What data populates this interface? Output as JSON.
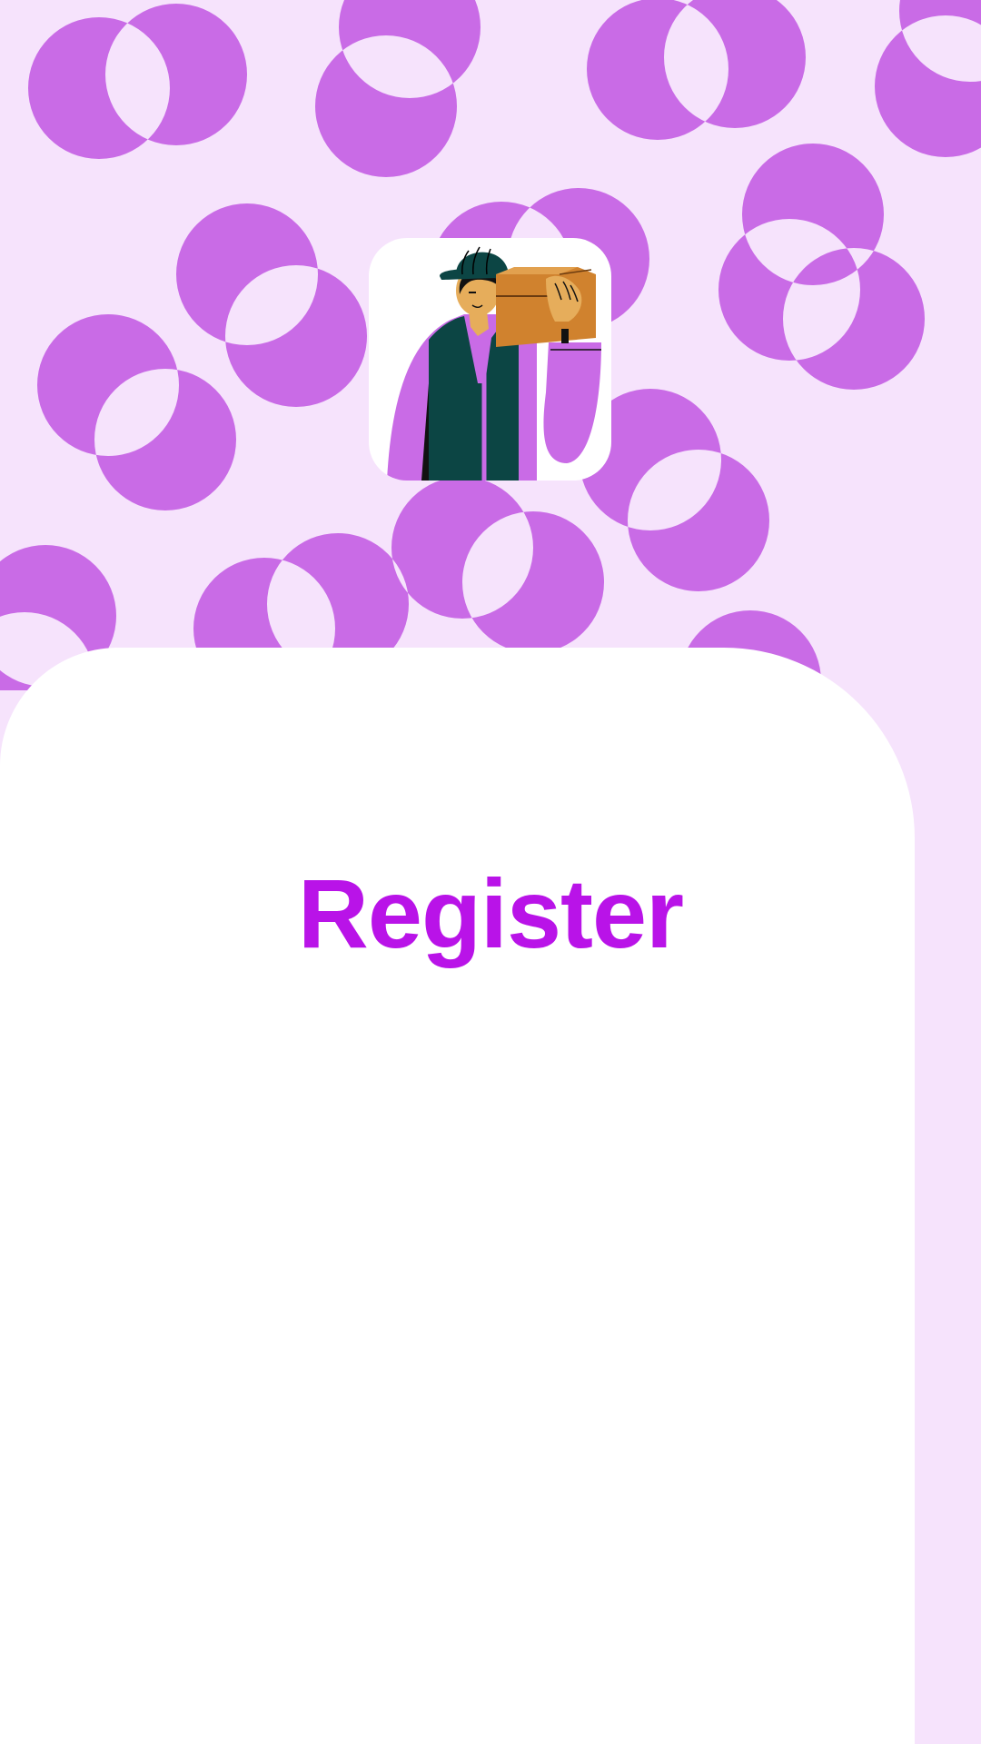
{
  "screen": {
    "title": "Register",
    "illustration": "delivery-worker-carrying-box-illustration"
  },
  "colors": {
    "background": "#f6e3fc",
    "pattern_circles": "#c96be6",
    "sheet": "#ffffff",
    "title": "#b913e8"
  }
}
